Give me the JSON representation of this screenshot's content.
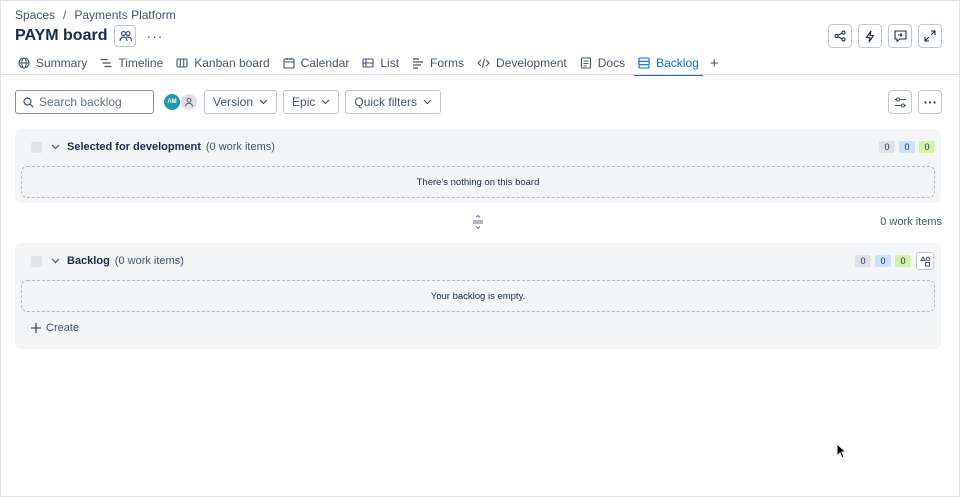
{
  "breadcrumb": {
    "space": "Spaces",
    "separator": "/",
    "project": "Payments Platform"
  },
  "board": {
    "title": "PAYM board"
  },
  "tabs": [
    {
      "label": "Summary",
      "icon": "globe-icon"
    },
    {
      "label": "Timeline",
      "icon": "timeline-icon"
    },
    {
      "label": "Kanban board",
      "icon": "board-icon"
    },
    {
      "label": "Calendar",
      "icon": "calendar-icon"
    },
    {
      "label": "List",
      "icon": "list-icon"
    },
    {
      "label": "Forms",
      "icon": "forms-icon"
    },
    {
      "label": "Development",
      "icon": "code-icon"
    },
    {
      "label": "Docs",
      "icon": "docs-icon"
    },
    {
      "label": "Backlog",
      "icon": "backlog-icon",
      "active": true
    }
  ],
  "toolbar": {
    "search_placeholder": "Search backlog",
    "avatar_initials": "AM",
    "version_label": "Version",
    "epic_label": "Epic",
    "quick_filters_label": "Quick filters"
  },
  "sections": {
    "selected": {
      "title": "Selected for development",
      "count": "(0 work items)",
      "counters": [
        "0",
        "0",
        "0"
      ],
      "empty_text": "There's nothing on this board"
    },
    "summary_count": "0 work items",
    "backlog": {
      "title": "Backlog",
      "count": "(0 work items)",
      "counters": [
        "0",
        "0",
        "0"
      ],
      "empty_text": "Your backlog is empty.",
      "create_label": "Create"
    }
  },
  "colors": {
    "accent": "#0c66e4",
    "panel_bg": "#f4f5f7",
    "avatar_bg": "#1d9aaa"
  }
}
